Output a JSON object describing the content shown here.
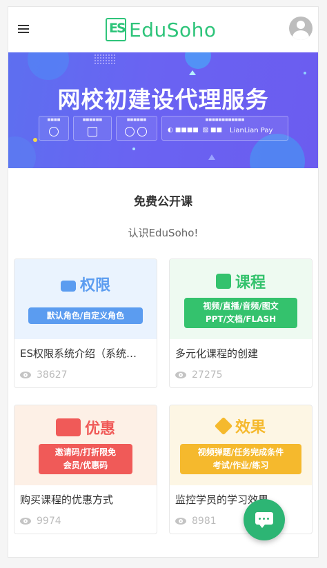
{
  "header": {
    "logo_text": "EduSoho",
    "logo_mark": "ES",
    "menu_icon": "hamburger-menu-icon",
    "avatar_icon": "user-avatar-icon"
  },
  "banner": {
    "title": "网校初建设代理服务",
    "pay_brand": "LianLian Pay"
  },
  "section": {
    "title": "免费公开课",
    "subtitle": "认识EduSoho!"
  },
  "courses": [
    {
      "cover_title": "权限",
      "cover_line1": "默认角色/自定义角色",
      "cover_line2": "",
      "name": "ES权限系统介绍（系统…",
      "views": "38627",
      "accent": "#5b9cf0",
      "cover_bg": "#eaf3fe"
    },
    {
      "cover_title": "课程",
      "cover_line1": "视频/直播/音频/图文",
      "cover_line2": "PPT/文档/FLASH",
      "name": "多元化课程的创建",
      "views": "27275",
      "accent": "#34c26d",
      "cover_bg": "#eefaf1"
    },
    {
      "cover_title": "优惠",
      "cover_line1": "邀请码/打折限免",
      "cover_line2": "会员/优惠码",
      "name": "购买课程的优惠方式",
      "views": "9974",
      "accent": "#f05a58",
      "cover_bg": "#fdf0e6"
    },
    {
      "cover_title": "效果",
      "cover_line1": "视频弹题/任务完成条件",
      "cover_line2": "考试/作业/练习",
      "name": "监控学员的学习效果",
      "views": "8981",
      "accent": "#f5b92d",
      "cover_bg": "#fdf6e4"
    }
  ],
  "floating": {
    "chat_icon": "chat-bubble-icon",
    "color": "#2db574"
  },
  "colors": {
    "brand": "#2ec47a",
    "banner": "#6a63f2"
  }
}
